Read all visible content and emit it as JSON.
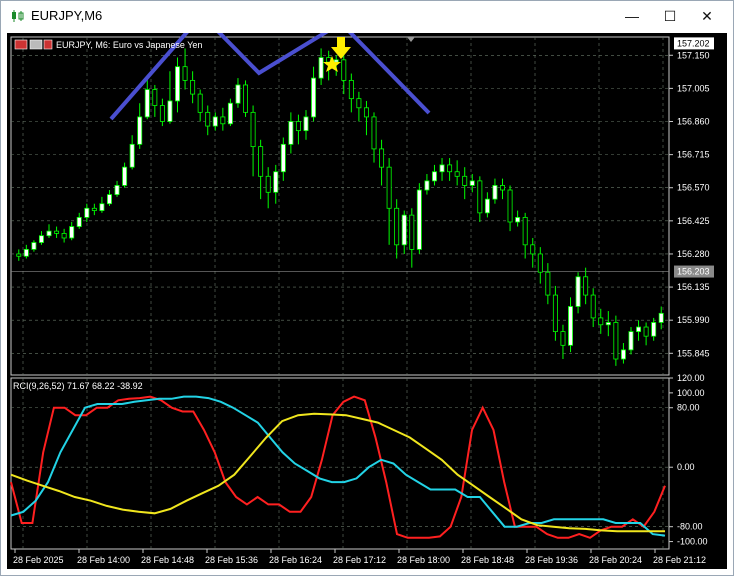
{
  "window": {
    "title": "EURJPY,M6",
    "buttons": {
      "minimize": "—",
      "maximize": "☐",
      "close": "✕"
    }
  },
  "chart": {
    "symbol_label": "EURJPY, M6:  Euro vs Japanese Yen",
    "indicator_label": "RCI(9,26,52) 71.67 68.22 -38.92",
    "colors": {
      "background": "#000000",
      "bull": "#ffffff",
      "bear": "#00ff00",
      "rci_short": "#ff2020",
      "rci_mid": "#22d3e6",
      "rci_long": "#f0e61e",
      "pattern": "#4a4fd0",
      "signal": "#ffee00"
    }
  },
  "chart_data": [
    {
      "type": "candlestick",
      "price_axis_labels": [
        "157.150",
        "157.005",
        "156.860",
        "156.715",
        "156.570",
        "156.425",
        "156.280",
        "156.135",
        "155.990",
        "155.845"
      ],
      "current_price": "157.202",
      "bid_line": "156.203",
      "ylim": [
        155.75,
        157.23
      ],
      "candles": [
        [
          156.28,
          156.27,
          156.3,
          156.25
        ],
        [
          156.27,
          156.3,
          156.32,
          156.26
        ],
        [
          156.3,
          156.33,
          156.34,
          156.29
        ],
        [
          156.33,
          156.36,
          156.38,
          156.32
        ],
        [
          156.36,
          156.38,
          156.41,
          156.35
        ],
        [
          156.38,
          156.37,
          156.4,
          156.35
        ],
        [
          156.37,
          156.35,
          156.39,
          156.33
        ],
        [
          156.35,
          156.4,
          156.42,
          156.34
        ],
        [
          156.4,
          156.44,
          156.46,
          156.39
        ],
        [
          156.44,
          156.48,
          156.5,
          156.42
        ],
        [
          156.48,
          156.47,
          156.5,
          156.45
        ],
        [
          156.47,
          156.5,
          156.53,
          156.46
        ],
        [
          156.5,
          156.54,
          156.56,
          156.49
        ],
        [
          156.54,
          156.58,
          156.6,
          156.53
        ],
        [
          156.58,
          156.66,
          156.68,
          156.57
        ],
        [
          156.66,
          156.76,
          156.8,
          156.65
        ],
        [
          156.76,
          156.88,
          156.94,
          156.74
        ],
        [
          156.88,
          157.0,
          157.05,
          156.87
        ],
        [
          157.0,
          156.93,
          157.02,
          156.88
        ],
        [
          156.93,
          156.86,
          156.96,
          156.84
        ],
        [
          156.86,
          156.95,
          157.08,
          156.85
        ],
        [
          156.95,
          157.1,
          157.14,
          156.9
        ],
        [
          157.1,
          157.04,
          157.18,
          157.0
        ],
        [
          157.04,
          156.98,
          157.08,
          156.94
        ],
        [
          156.98,
          156.9,
          157.0,
          156.86
        ],
        [
          156.9,
          156.84,
          156.93,
          156.8
        ],
        [
          156.84,
          156.88,
          156.9,
          156.82
        ],
        [
          156.88,
          156.85,
          156.92,
          156.82
        ],
        [
          156.85,
          156.94,
          156.96,
          156.84
        ],
        [
          156.94,
          157.02,
          157.05,
          156.92
        ],
        [
          157.02,
          156.9,
          157.04,
          156.88
        ],
        [
          156.9,
          156.75,
          156.93,
          156.62
        ],
        [
          156.75,
          156.62,
          156.78,
          156.52
        ],
        [
          156.62,
          156.55,
          156.66,
          156.48
        ],
        [
          156.55,
          156.64,
          156.67,
          156.5
        ],
        [
          156.64,
          156.76,
          156.79,
          156.6
        ],
        [
          156.76,
          156.86,
          156.9,
          156.72
        ],
        [
          156.86,
          156.82,
          156.89,
          156.76
        ],
        [
          156.82,
          156.88,
          156.91,
          156.78
        ],
        [
          156.88,
          157.05,
          157.1,
          156.86
        ],
        [
          157.05,
          157.14,
          157.18,
          157.02
        ],
        [
          157.14,
          157.12,
          157.17,
          157.04
        ],
        [
          157.12,
          157.13,
          157.15,
          157.06
        ],
        [
          157.13,
          157.04,
          157.15,
          156.98
        ],
        [
          157.04,
          156.96,
          157.07,
          156.9
        ],
        [
          156.96,
          156.92,
          156.99,
          156.86
        ],
        [
          156.92,
          156.88,
          156.95,
          156.8
        ],
        [
          156.88,
          156.74,
          156.9,
          156.68
        ],
        [
          156.74,
          156.66,
          156.78,
          156.58
        ],
        [
          156.66,
          156.48,
          156.7,
          156.32
        ],
        [
          156.48,
          156.32,
          156.52,
          156.26
        ],
        [
          156.32,
          156.45,
          156.47,
          156.28
        ],
        [
          156.45,
          156.3,
          156.48,
          156.22
        ],
        [
          156.3,
          156.56,
          156.59,
          156.28
        ],
        [
          156.56,
          156.6,
          156.63,
          156.54
        ],
        [
          156.6,
          156.64,
          156.67,
          156.58
        ],
        [
          156.64,
          156.67,
          156.7,
          156.6
        ],
        [
          156.67,
          156.64,
          156.7,
          156.6
        ],
        [
          156.64,
          156.62,
          156.69,
          156.58
        ],
        [
          156.62,
          156.58,
          156.66,
          156.52
        ],
        [
          156.58,
          156.6,
          156.63,
          156.55
        ],
        [
          156.6,
          156.46,
          156.62,
          156.42
        ],
        [
          156.46,
          156.52,
          156.55,
          156.44
        ],
        [
          156.52,
          156.58,
          156.61,
          156.5
        ],
        [
          156.58,
          156.56,
          156.61,
          156.52
        ],
        [
          156.56,
          156.42,
          156.58,
          156.38
        ],
        [
          156.42,
          156.44,
          156.47,
          156.4
        ],
        [
          156.44,
          156.32,
          156.46,
          156.26
        ],
        [
          156.32,
          156.28,
          156.35,
          156.22
        ],
        [
          156.28,
          156.2,
          156.31,
          156.15
        ],
        [
          156.2,
          156.1,
          156.24,
          156.06
        ],
        [
          156.1,
          155.94,
          156.14,
          155.9
        ],
        [
          155.94,
          155.88,
          155.97,
          155.82
        ],
        [
          155.88,
          156.05,
          156.09,
          155.85
        ],
        [
          156.05,
          156.18,
          156.2,
          156.02
        ],
        [
          156.18,
          156.1,
          156.22,
          156.06
        ],
        [
          156.1,
          156.0,
          156.13,
          155.96
        ],
        [
          156.0,
          155.97,
          156.04,
          155.93
        ],
        [
          155.97,
          155.98,
          156.03,
          155.92
        ],
        [
          155.98,
          155.82,
          156.01,
          155.79
        ],
        [
          155.82,
          155.86,
          155.89,
          155.8
        ],
        [
          155.86,
          155.94,
          155.96,
          155.84
        ],
        [
          155.94,
          155.96,
          155.99,
          155.9
        ],
        [
          155.96,
          155.92,
          155.98,
          155.88
        ],
        [
          155.92,
          155.98,
          156.0,
          155.9
        ],
        [
          155.98,
          156.02,
          156.05,
          155.95
        ]
      ]
    },
    {
      "type": "line",
      "name": "RCI(9,26,52)",
      "axis_labels": [
        "120.00",
        "100.00",
        "80.00",
        "0.00",
        "-80.00",
        "-100.00"
      ],
      "ylim": [
        -110,
        120
      ],
      "x_tick_labels": [
        "28 Feb 2025",
        "28 Feb 14:00",
        "28 Feb 14:48",
        "28 Feb 15:36",
        "28 Feb 16:24",
        "28 Feb 17:12",
        "28 Feb 18:00",
        "28 Feb 18:48",
        "28 Feb 19:36",
        "28 Feb 20:24",
        "28 Feb 21:12"
      ],
      "series": [
        {
          "values": [
            -20,
            -75,
            -75,
            20,
            80,
            80,
            70,
            70,
            80,
            80,
            90,
            92,
            93,
            95,
            90,
            80,
            75,
            75,
            50,
            20,
            -20,
            -40,
            -50,
            -40,
            -50,
            -50,
            -60,
            -60,
            -40,
            10,
            70,
            88,
            95,
            90,
            40,
            -20,
            -90,
            -95,
            -95,
            -95,
            -93,
            -80,
            -40,
            50,
            80,
            50,
            -20,
            -80,
            -80,
            -80,
            -90,
            -95,
            -95,
            -90,
            -95,
            -85,
            -80,
            -80,
            -70,
            -80,
            -60,
            -25
          ]
        },
        {
          "values": [
            -65,
            -60,
            -45,
            -20,
            20,
            50,
            80,
            85,
            85,
            85,
            88,
            90,
            92,
            92,
            95,
            95,
            93,
            88,
            80,
            70,
            60,
            40,
            20,
            5,
            -5,
            -15,
            -20,
            -20,
            -15,
            0,
            10,
            5,
            -10,
            -20,
            -30,
            -30,
            -30,
            -40,
            -40,
            -60,
            -80,
            -80,
            -75,
            -75,
            -70,
            -70,
            -70,
            -70,
            -70,
            -75,
            -75,
            -75,
            -90,
            -92
          ]
        },
        {
          "values": [
            -10,
            -18,
            -25,
            -32,
            -40,
            -45,
            -52,
            -57,
            -60,
            -62,
            -56,
            -45,
            -35,
            -25,
            -10,
            15,
            40,
            62,
            70,
            72,
            71,
            70,
            65,
            60,
            50,
            40,
            25,
            10,
            -10,
            -25,
            -40,
            -55,
            -70,
            -78,
            -80,
            -82,
            -83,
            -85,
            -86,
            -86,
            -86,
            -86
          ]
        }
      ]
    }
  ]
}
